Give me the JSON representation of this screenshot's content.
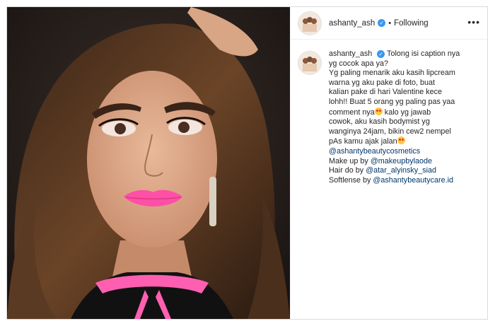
{
  "post": {
    "username": "ashanty_ash",
    "dot": "•",
    "follow_status": "Following",
    "more_label": "•••"
  },
  "caption": {
    "username": "ashanty_ash",
    "lines": [
      "Tolong isi caption nya",
      "yg cocok apa ya?",
      "Yg paling menarik aku kasih lipcream",
      "warna yg aku pake di foto, buat",
      "kalian pake di hari Valentine kece",
      "lohh!! Buat 5 orang yg paling pas yaa",
      "comment nya",
      " kalo yg jawab",
      "cowok, aku kasih bodymist yg",
      "wanginya 24jam, bikin cew2 nempel",
      "pAs kamu ajak jalan",
      "@ashantybeautycosmetics",
      "Make up by ",
      "@makeupbylaode",
      "Hair do by ",
      "@atar_alyinsky_siad",
      "Softlense by ",
      "@ashantybeautycare.id"
    ]
  },
  "colors": {
    "verified": "#3897f0",
    "mention": "#00376b",
    "border": "#dbdbdb"
  },
  "icons": {
    "verified": "verified-badge-icon",
    "more": "more-options-icon",
    "emoji": "heart-eyes-emoji-icon"
  }
}
